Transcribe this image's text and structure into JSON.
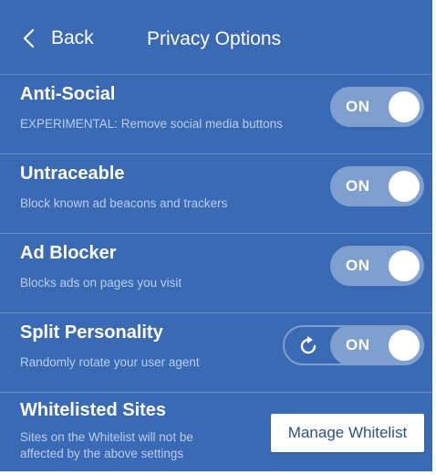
{
  "header": {
    "back_label": "Back",
    "title": "Privacy Options"
  },
  "options": [
    {
      "title": "Anti-Social",
      "description": "EXPERIMENTAL: Remove social media buttons",
      "toggle": "ON"
    },
    {
      "title": "Untraceable",
      "description": "Block known ad beacons and trackers",
      "toggle": "ON"
    },
    {
      "title": "Ad Blocker",
      "description": "Blocks ads on pages you visit",
      "toggle": "ON"
    },
    {
      "title": "Split Personality",
      "description": "Randomly rotate your user agent",
      "toggle": "ON"
    }
  ],
  "whitelist": {
    "title": "Whitelisted Sites",
    "description": "Sites on the Whitelist will not be affected by the above settings",
    "button_label": "Manage Whitelist"
  },
  "colors": {
    "background": "#3a6ab3",
    "toggle_track": "#7fa0cf",
    "description_text": "#b9cdea"
  },
  "icons": {
    "back": "chevron-left-icon",
    "rotate": "refresh-icon"
  }
}
